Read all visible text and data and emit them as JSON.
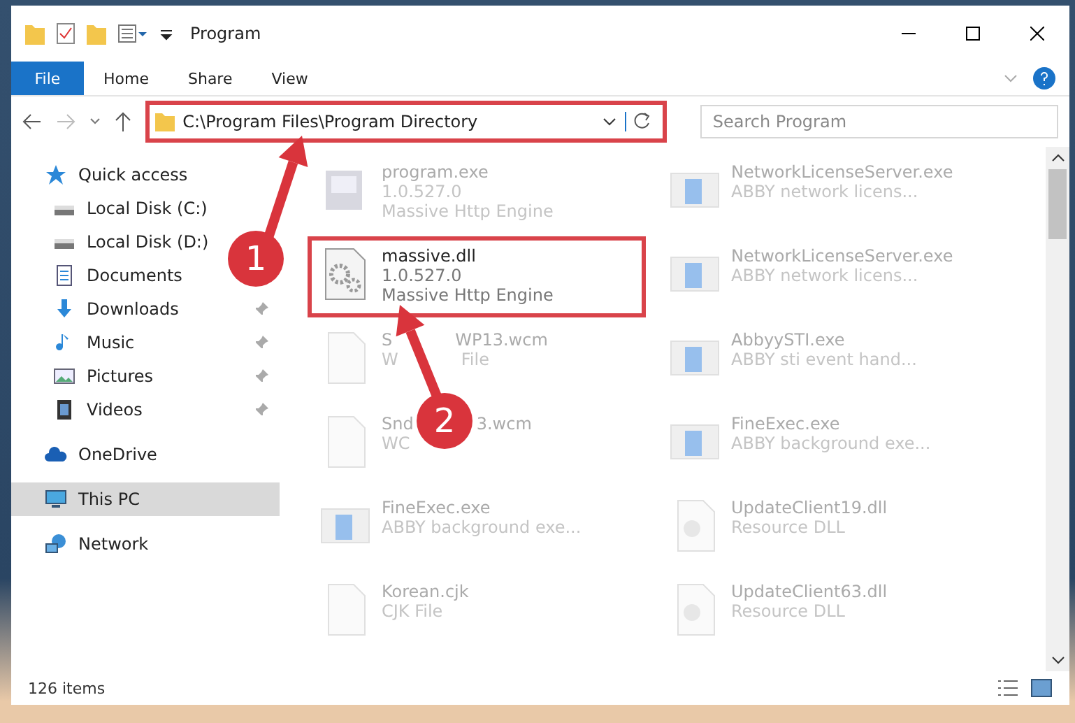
{
  "window": {
    "title": "Program"
  },
  "ribbon_tabs": [
    {
      "label": "File",
      "kind": "file"
    },
    {
      "label": "Home",
      "kind": "tab"
    },
    {
      "label": "Share",
      "kind": "tab"
    },
    {
      "label": "View",
      "kind": "tab"
    }
  ],
  "address_bar": {
    "path": "C:\\Program Files\\Program Directory",
    "annotated": true
  },
  "search": {
    "placeholder": "Search Program"
  },
  "sidebar": {
    "items": [
      {
        "label": "Quick access",
        "selected": false,
        "children": [
          {
            "label": "Local Disk (C:)",
            "pinned": false,
            "selected": false
          },
          {
            "label": "Local Disk (D:)",
            "pinned": false,
            "selected": false
          },
          {
            "label": "Documents",
            "pinned": false,
            "selected": false
          },
          {
            "label": "Downloads",
            "pinned": true,
            "selected": false
          },
          {
            "label": "Music",
            "pinned": true,
            "selected": false
          },
          {
            "label": "Pictures",
            "pinned": true,
            "selected": false
          },
          {
            "label": "Videos",
            "pinned": true,
            "selected": false
          }
        ]
      },
      {
        "label": "OneDrive",
        "selected": false
      },
      {
        "label": "This PC",
        "selected": true
      },
      {
        "label": "Network",
        "selected": false
      }
    ]
  },
  "files": [
    {
      "kind": "program",
      "name": [
        "program.exe"
      ],
      "lines": [
        [
          "1.0.527.0"
        ],
        [
          "Massive Http Engine"
        ]
      ],
      "faded": true,
      "annotated": false
    },
    {
      "kind": "gear",
      "name": [
        "massive.dll"
      ],
      "lines": [
        [
          "1.0.527.0"
        ],
        [
          "Massive Http Engine"
        ]
      ],
      "faded": false,
      "annotated": true
    },
    {
      "kind": "blank",
      "name": [
        "S",
        "WP13.wcm"
      ],
      "lines": [
        [
          "W",
          "File"
        ]
      ],
      "faded": true,
      "annotated": false
    },
    {
      "kind": "blank",
      "name": [
        "Snd",
        "3.wcm"
      ],
      "lines": [
        [
          "WC"
        ]
      ],
      "faded": true,
      "annotated": false
    },
    {
      "kind": "app",
      "name": [
        "FineExec.exe"
      ],
      "lines": [
        [
          "ABBY background exe..."
        ]
      ],
      "faded": true,
      "annotated": false
    },
    {
      "kind": "blank",
      "name": [
        "Korean.cjk"
      ],
      "lines": [
        [
          "CJK File"
        ]
      ],
      "faded": true,
      "annotated": false
    },
    {
      "kind": "app",
      "name": [
        "NetworkLicenseServer.exe"
      ],
      "lines": [
        [
          "ABBY network licens..."
        ]
      ],
      "faded": true,
      "annotated": false
    },
    {
      "kind": "app",
      "name": [
        "NetworkLicenseServer.exe"
      ],
      "lines": [
        [
          "ABBY network licens..."
        ]
      ],
      "faded": true,
      "annotated": false
    },
    {
      "kind": "app",
      "name": [
        "AbbyySTI.exe"
      ],
      "lines": [
        [
          "ABBY sti event hand..."
        ]
      ],
      "faded": true,
      "annotated": false
    },
    {
      "kind": "app",
      "name": [
        "FineExec.exe"
      ],
      "lines": [
        [
          "ABBY background exe..."
        ]
      ],
      "faded": true,
      "annotated": false
    },
    {
      "kind": "dll",
      "name": [
        "UpdateClient19.dll"
      ],
      "lines": [
        [
          "Resource DLL"
        ]
      ],
      "faded": true,
      "annotated": false
    },
    {
      "kind": "dll",
      "name": [
        "UpdateClient63.dll"
      ],
      "lines": [
        [
          "Resource DLL"
        ]
      ],
      "faded": true,
      "annotated": false
    }
  ],
  "status_bar": {
    "count": "126 items"
  },
  "annotations": [
    {
      "label": "1"
    },
    {
      "label": "2"
    }
  ]
}
